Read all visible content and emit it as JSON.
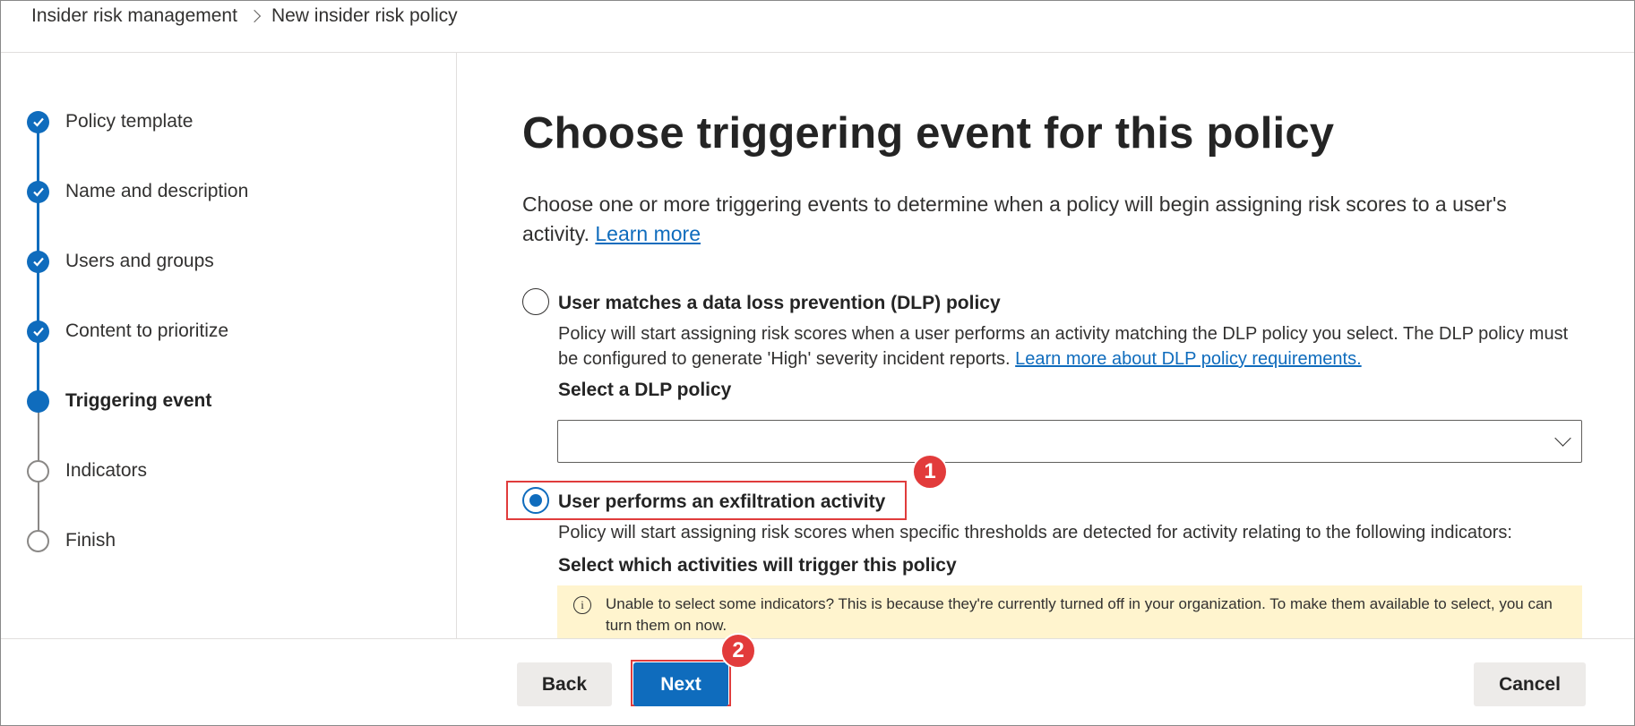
{
  "breadcrumb": {
    "root": "Insider risk management",
    "current": "New insider risk policy"
  },
  "steps": [
    {
      "label": "Policy template",
      "state": "done"
    },
    {
      "label": "Name and description",
      "state": "done"
    },
    {
      "label": "Users and groups",
      "state": "done"
    },
    {
      "label": "Content to prioritize",
      "state": "done"
    },
    {
      "label": "Triggering event",
      "state": "current"
    },
    {
      "label": "Indicators",
      "state": "todo"
    },
    {
      "label": "Finish",
      "state": "todo"
    }
  ],
  "main": {
    "title": "Choose triggering event for this policy",
    "intro": "Choose one or more triggering events to determine when a policy will begin assigning risk scores to a user's activity.",
    "intro_link": "Learn more",
    "option_dlp": {
      "title": "User matches a data loss prevention (DLP) policy",
      "description": "Policy will start assigning risk scores when a user performs an activity matching the DLP policy you select. The DLP policy must be configured to generate 'High' severity incident reports.",
      "link": "Learn more about DLP policy requirements.",
      "checked": false,
      "select_label": "Select a DLP policy",
      "select_value": ""
    },
    "option_exfil": {
      "title": "User performs an exfiltration activity",
      "description": "Policy will start assigning risk scores when specific thresholds are detected for activity relating to the following indicators:",
      "checked": true,
      "activities_label": "Select which activities will trigger this policy"
    },
    "info_message": "Unable to select some indicators? This is because they're currently turned off in your organization. To make them available to select, you can turn them on now."
  },
  "annotations": {
    "badge_1": "1",
    "badge_2": "2",
    "highlight_color": "#e03c3c"
  },
  "footer": {
    "back_label": "Back",
    "next_label": "Next",
    "cancel_label": "Cancel"
  },
  "colors": {
    "accent": "#0f6cbd",
    "info_bg": "#fff4ce"
  }
}
